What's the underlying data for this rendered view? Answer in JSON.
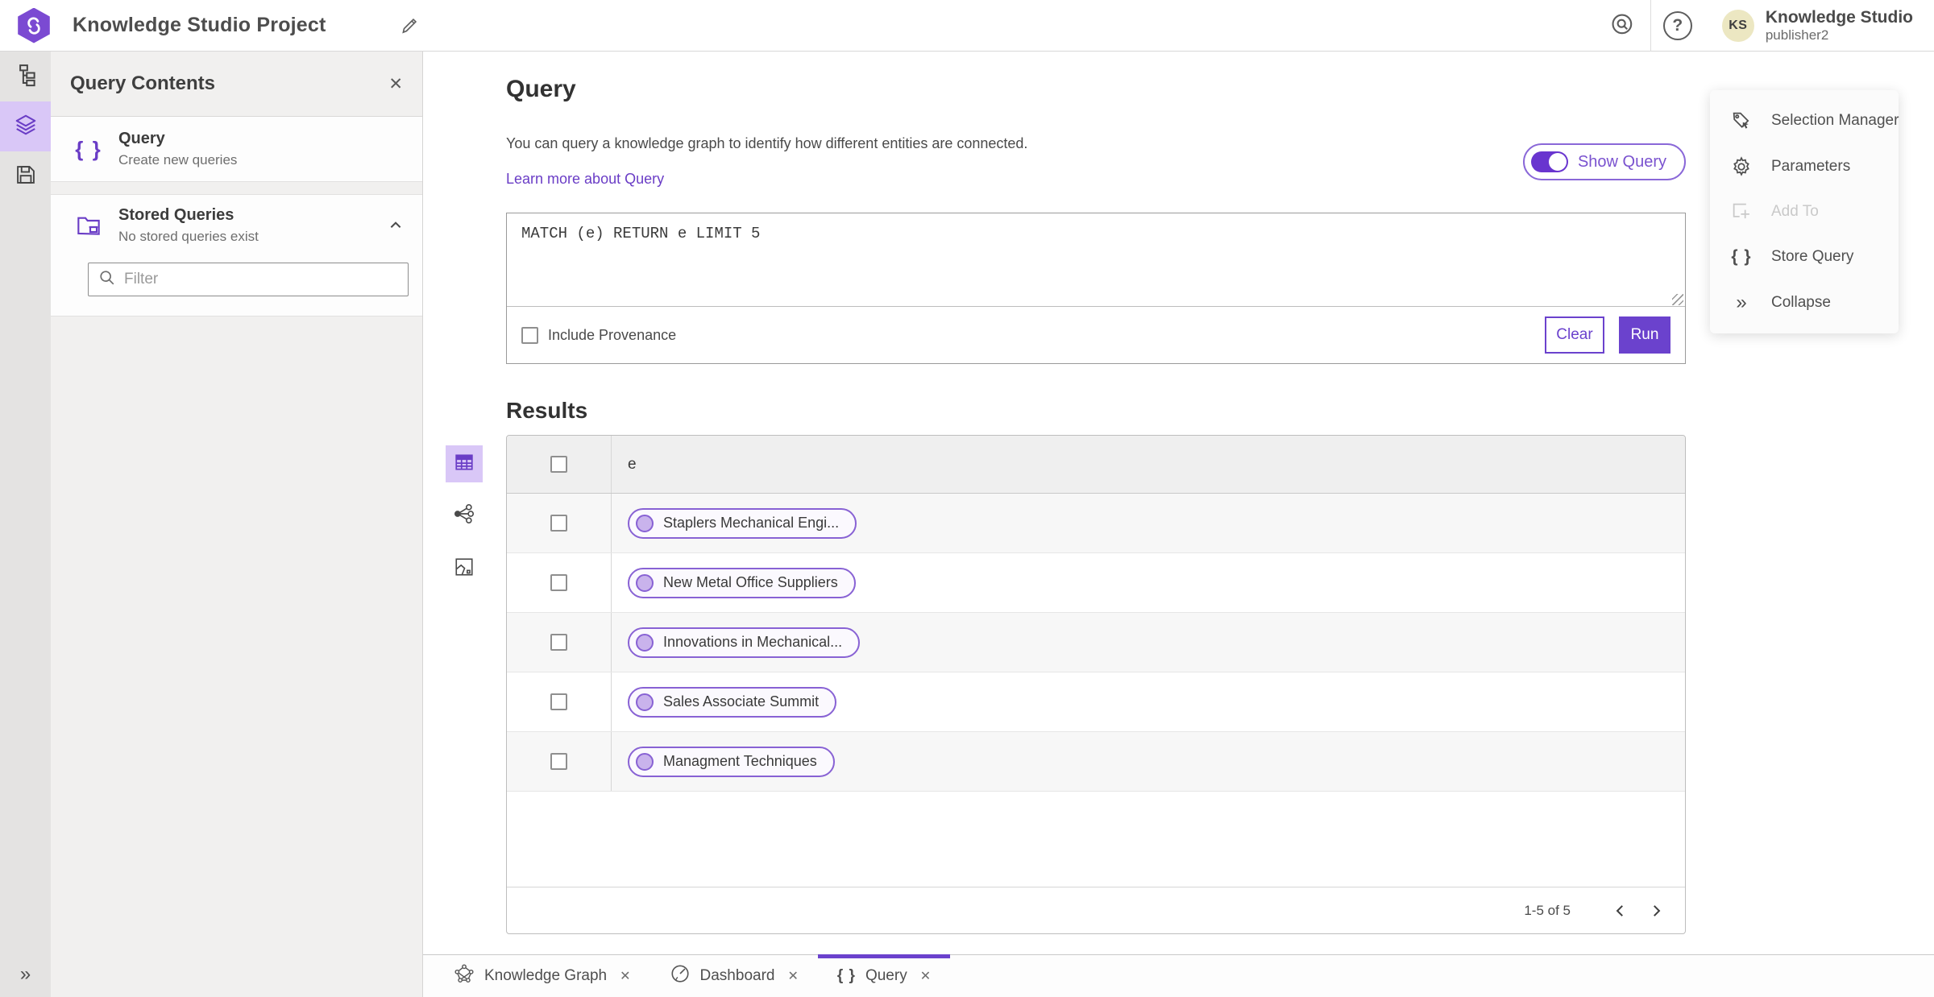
{
  "colors": {
    "accent": "#6b42cd",
    "accent_dark": "#6a3dc6",
    "accent_light_bg": "#d9c7f7",
    "pill_border": "#8862d4",
    "pill_circle_fill": "#c9b3ec",
    "avatar_bg": "#ece7c2",
    "rail_bg": "#e4e3e2",
    "panel_bg": "#f1f0ef",
    "table_header_bg": "#efefef",
    "row_stripe_bg": "#f7f7f7"
  },
  "glyphs": {
    "close": "✕",
    "braces": "{ }",
    "collapse": "»",
    "rail_expander": "»",
    "question": "?"
  },
  "topbar": {
    "title": "Knowledge Studio Project",
    "user": {
      "initials": "KS",
      "name": "Knowledge Studio",
      "role": "publisher2"
    }
  },
  "panel": {
    "title": "Query Contents",
    "query_item": {
      "title": "Query",
      "subtitle": "Create new queries"
    },
    "stored_item": {
      "title": "Stored Queries",
      "subtitle": "No stored queries exist"
    },
    "filter_placeholder": "Filter"
  },
  "main": {
    "heading": "Query",
    "description": "You can query a knowledge graph to identify how different entities are connected.",
    "learn_more": "Learn more about Query",
    "show_query": "Show Query",
    "query_text": "MATCH (e) RETURN e LIMIT 5",
    "include_provenance": "Include Provenance",
    "clear": "Clear",
    "run": "Run"
  },
  "results": {
    "heading": "Results",
    "column": "e",
    "rows": [
      "Staplers Mechanical Engi...",
      "New Metal Office Suppliers",
      "Innovations in Mechanical...",
      "Sales Associate Summit",
      "Managment Techniques"
    ],
    "pagination": "1-5 of 5"
  },
  "right_menu": {
    "items": [
      {
        "label": "Selection Manager"
      },
      {
        "label": "Parameters"
      },
      {
        "label": "Add To",
        "disabled": true
      },
      {
        "label": "Store Query"
      },
      {
        "label": "Collapse"
      }
    ]
  },
  "tabs": [
    {
      "label": "Knowledge Graph"
    },
    {
      "label": "Dashboard"
    },
    {
      "label": "Query",
      "active": true
    }
  ]
}
